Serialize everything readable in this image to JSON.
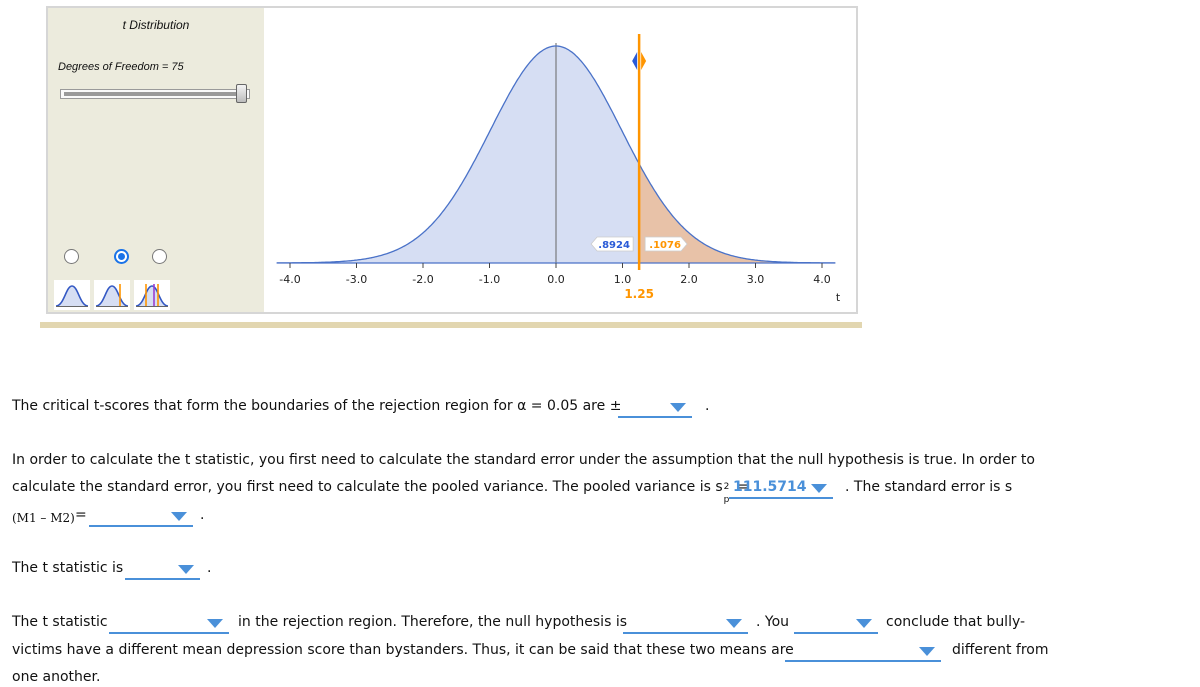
{
  "applet": {
    "title": "t Distribution",
    "dof_label": "Degrees of Freedom = 75",
    "dof_value": 75,
    "dof_slider_fraction": 1.0,
    "modes": [
      {
        "name": "no-tail",
        "selected": false
      },
      {
        "name": "one-tail",
        "selected": true
      },
      {
        "name": "two-tail",
        "selected": false
      }
    ],
    "colors": {
      "curve": "#4a72c8",
      "fill_left": "#d6def3",
      "fill_right": "#e8c2a8",
      "cutoff": "#ff9500",
      "left_label": "#2a5bd7",
      "right_label": "#ff9500"
    }
  },
  "chart_data": {
    "type": "area",
    "title": "t Distribution",
    "xlabel": "t",
    "ylabel": "",
    "xlim": [
      -4.2,
      4.2
    ],
    "x_ticks": [
      "-4.0",
      "-3.0",
      "-2.0",
      "-1.0",
      "0.0",
      "1.0",
      "2.0",
      "3.0",
      "4.0"
    ],
    "degrees_of_freedom": 75,
    "cutoff": 1.25,
    "cutoff_label": "1.25",
    "left_area": ".8924",
    "right_area": ".1076"
  },
  "q1": {
    "text": "The critical t-scores that form the boundaries of the rejection region for α = 0.05 are ±",
    "value": "",
    "end": "."
  },
  "q2": {
    "line1": "In order to calculate the t statistic, you first need to calculate the standard error under the assumption that the null hypothesis is true. In order to",
    "line2": "calculate the standard error, you first need to calculate the pooled variance. The pooled variance is s",
    "sp_sup": "2",
    "sp_sub": "p",
    "equals": "=",
    "pooled_variance_value": "111.5714",
    "after": ". The standard error is s",
    "se_label": "(M1 – M2)",
    "se_equals": "=",
    "se_value": "",
    "end": "."
  },
  "q3": {
    "text": "The t statistic is",
    "value": "",
    "end": "."
  },
  "q4": {
    "p1": "The t statistic",
    "p2": "in the rejection region. Therefore, the null hypothesis is",
    "p3": ". You",
    "p4": "conclude that bully-",
    "p5": "victims have a different mean depression score than bystanders. Thus, it can be said that these two means are",
    "p6": "different from",
    "p7": "one another.",
    "values": [
      "",
      "",
      "",
      ""
    ]
  }
}
